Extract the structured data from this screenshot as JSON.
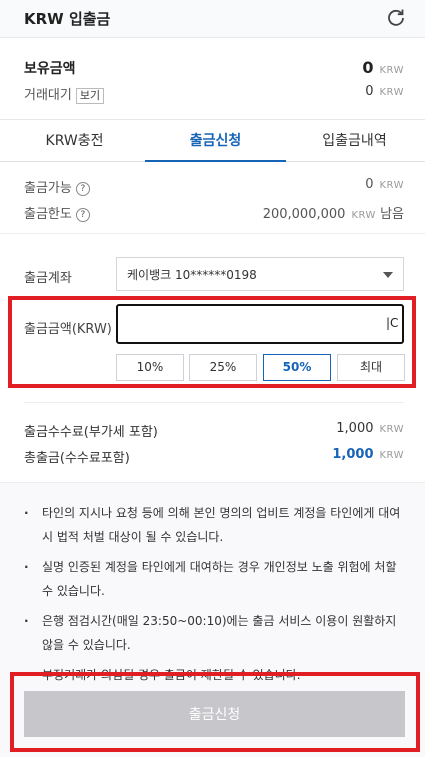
{
  "header": {
    "title": "KRW 입출금",
    "refresh_icon": "refresh-icon"
  },
  "holdings": {
    "balance_label": "보유금액",
    "balance_value": "0",
    "balance_unit": "KRW",
    "pending_label": "거래대기",
    "view_label": "보기",
    "pending_value": "0",
    "pending_unit": "KRW"
  },
  "tabs": [
    {
      "label": "KRW충전",
      "active": false
    },
    {
      "label": "출금신청",
      "active": true
    },
    {
      "label": "입출금내역",
      "active": false
    }
  ],
  "limits": {
    "available_label": "출금가능",
    "available_value": "0",
    "available_unit": "KRW",
    "limit_label": "출금한도",
    "limit_value": "200,000,000",
    "limit_unit": "KRW",
    "limit_suffix": "남음",
    "help_glyph": "?"
  },
  "form": {
    "account_label": "출금계좌",
    "account_value": "케이뱅크 10******0198",
    "amount_label": "출금금액(KRW)",
    "amount_value": "",
    "amount_caret": "|C",
    "percent_buttons": [
      {
        "label": "10%",
        "active": false
      },
      {
        "label": "25%",
        "active": false
      },
      {
        "label": "50%",
        "active": true
      },
      {
        "label": "최대",
        "active": false
      }
    ]
  },
  "fees": {
    "fee_label": "출금수수료(부가세 포함)",
    "fee_value": "1,000",
    "fee_unit": "KRW",
    "total_label": "총출금(수수료포함)",
    "total_value": "1,000",
    "total_unit": "KRW"
  },
  "notices": [
    "타인의 지시나 요청 등에 의해 본인 명의의 업비트 계정을 타인에게 대여시 법적 처벌 대상이 될 수 있습니다.",
    "실명 인증된 계정을 타인에게 대여하는 경우 개인정보 노출 위험에 처할 수 있습니다.",
    "은행 점검시간(매일 23:50~00:10)에는 출금 서비스 이용이 원활하지 않을 수 있습니다.",
    "부정거래가 의심될 경우 출금이 제한될 수 있습니다."
  ],
  "submit": {
    "label": "출금신청"
  },
  "colors": {
    "accent": "#1763b6",
    "highlight": "#e21e25",
    "disabled": "#c6c6cb"
  }
}
